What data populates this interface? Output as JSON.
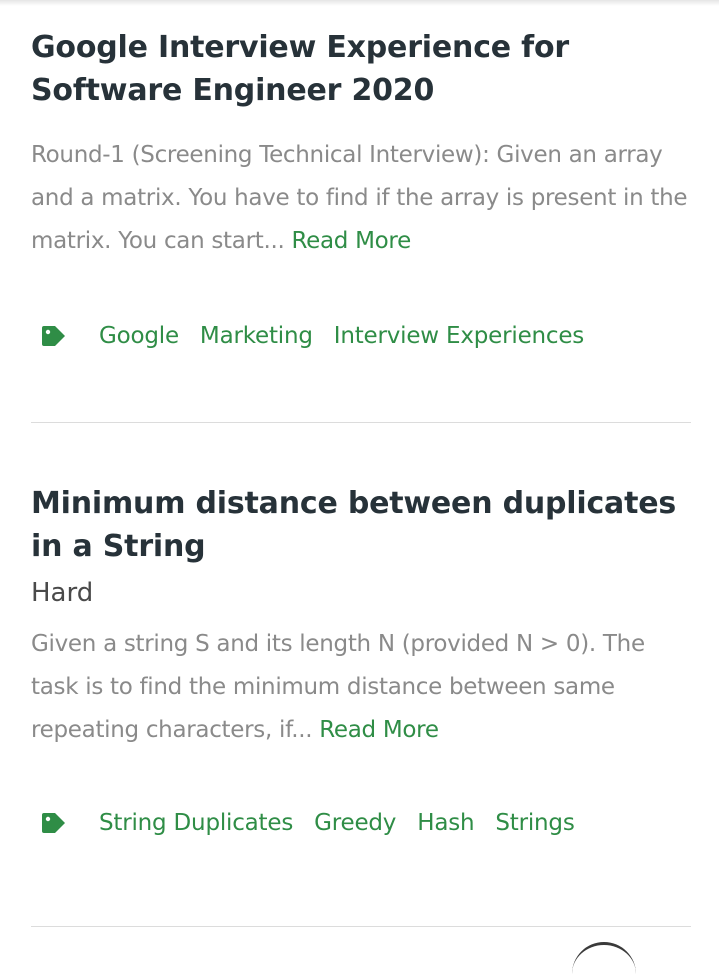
{
  "articles": [
    {
      "title": "Google Interview Experience for Software Engineer 2020",
      "excerpt": "Round-1 (Screening Technical Interview): Given an array and a matrix. You have to find if the array is present in the matrix. You can start... ",
      "read_more": "Read More",
      "tag_icon": "tag-icon",
      "tags": [
        "Google",
        "Marketing",
        "Interview Experiences"
      ]
    },
    {
      "title": "Minimum distance between duplicates in a String",
      "difficulty": "Hard",
      "excerpt": "Given a string S and its length N (provided N > 0). The task is to find the minimum distance between same repeating characters, if... ",
      "read_more": "Read More",
      "tag_icon": "tag-icon",
      "tags": [
        "String Duplicates",
        "Greedy",
        "Hash",
        "Strings"
      ]
    }
  ],
  "colors": {
    "title": "#273239",
    "excerpt": "#8a8a8a",
    "accent_green": "#2f8d46",
    "divider": "#dcdcdc"
  }
}
